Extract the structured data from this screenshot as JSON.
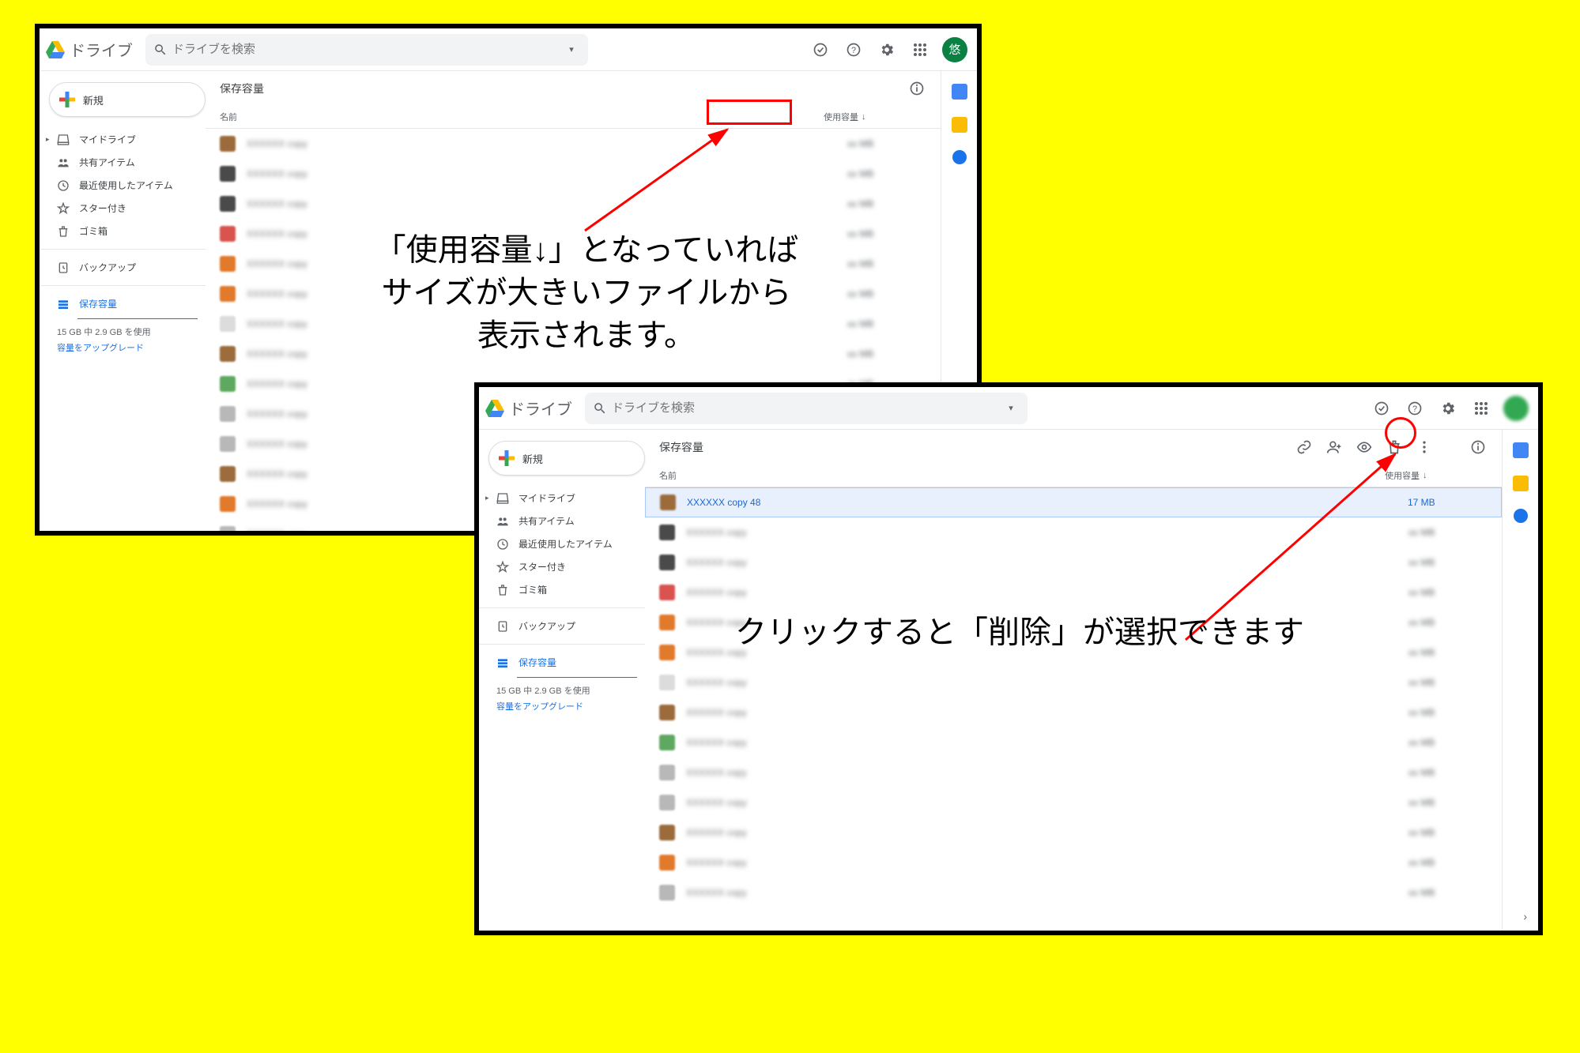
{
  "app": {
    "name": "ドライブ",
    "search_placeholder": "ドライブを検索"
  },
  "avatar_char": "悠",
  "sidebar": {
    "new_label": "新規",
    "items": [
      {
        "label": "マイドライブ"
      },
      {
        "label": "共有アイテム"
      },
      {
        "label": "最近使用したアイテム"
      },
      {
        "label": "スター付き"
      },
      {
        "label": "ゴミ箱"
      },
      {
        "label": "バックアップ"
      },
      {
        "label": "保存容量"
      }
    ],
    "storage_used": "15 GB 中 2.9 GB を使用",
    "upgrade": "容量をアップグレード"
  },
  "section_title": "保存容量",
  "columns": {
    "name": "名前",
    "size": "使用容量",
    "sort_arrow": "↓"
  },
  "window1": {
    "files": [
      {
        "thumb": "th-brown"
      },
      {
        "thumb": "th-dark"
      },
      {
        "thumb": "th-dark"
      },
      {
        "thumb": "th-red"
      },
      {
        "thumb": "th-orange"
      },
      {
        "thumb": "th-orange"
      },
      {
        "thumb": "th-pale"
      },
      {
        "thumb": "th-brown"
      },
      {
        "thumb": "th-green"
      },
      {
        "thumb": "th-grey"
      },
      {
        "thumb": "th-grey"
      },
      {
        "thumb": "th-brown"
      },
      {
        "thumb": "th-orange"
      },
      {
        "thumb": "th-grey"
      }
    ]
  },
  "window2": {
    "selected_file": {
      "name": "XXXXXX copy 48",
      "size": "17 MB",
      "thumb": "th-brown"
    },
    "files": [
      {
        "thumb": "th-dark"
      },
      {
        "thumb": "th-dark"
      },
      {
        "thumb": "th-red"
      },
      {
        "thumb": "th-orange"
      },
      {
        "thumb": "th-orange"
      },
      {
        "thumb": "th-pale"
      },
      {
        "thumb": "th-brown"
      },
      {
        "thumb": "th-green"
      },
      {
        "thumb": "th-grey"
      },
      {
        "thumb": "th-grey"
      },
      {
        "thumb": "th-brown"
      },
      {
        "thumb": "th-orange"
      },
      {
        "thumb": "th-grey"
      }
    ]
  },
  "annotations": {
    "text1_l1": "「使用容量↓」となっていれば",
    "text1_l2": "サイズが大きいファイルから",
    "text1_l3": "表示されます。",
    "text2": "クリックすると「削除」が選択できます"
  }
}
